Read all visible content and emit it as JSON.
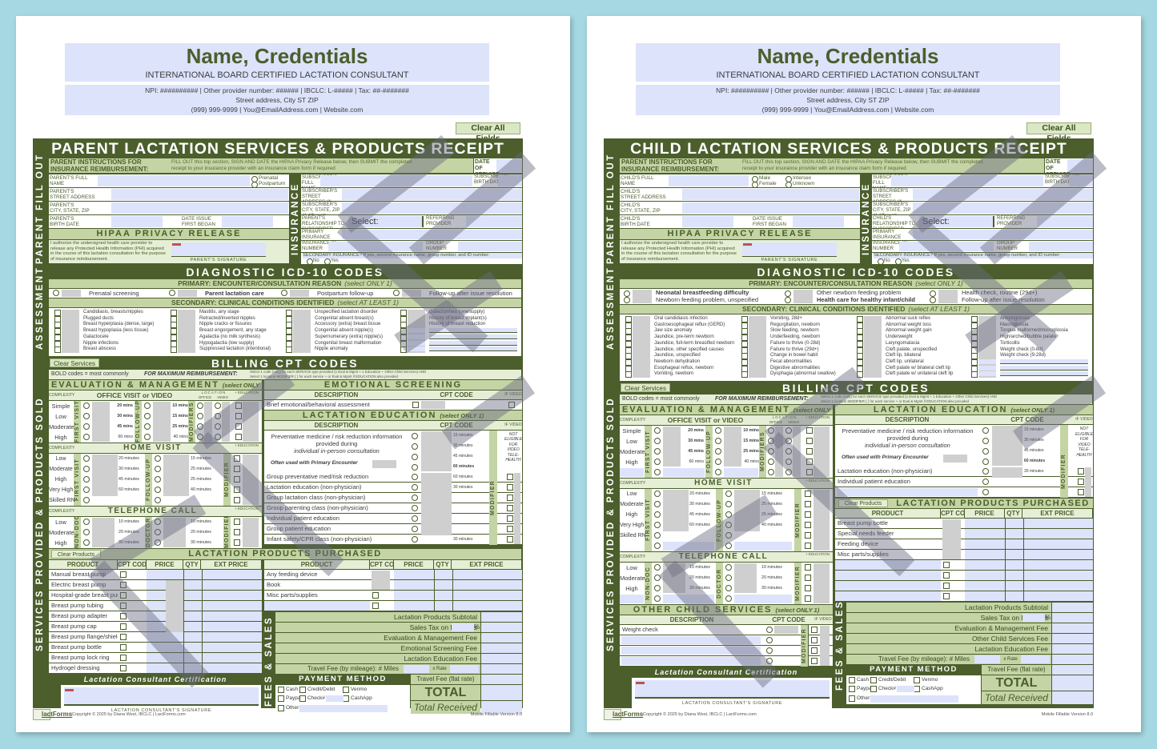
{
  "header": {
    "name": "Name, Credentials",
    "subtitle": "INTERNATIONAL BOARD CERTIFIED LACTATION CONSULTANT",
    "ids_line": "NPI: ########## | Other provider number: ###### | IBCLC: L-##### | Tax: ##-#######",
    "address": "Street address, City ST ZIP",
    "contact": "(999) 999-9999 | You@EmailAddress.com | Website.com"
  },
  "buttons": {
    "clear_all": "Clear All Fields",
    "clear_services": "Clear Services",
    "clear_products": "Clear Products"
  },
  "common": {
    "instructions_title": "PARENT INSTRUCTIONS FOR INSURANCE REIMBURSEMENT:",
    "instructions_text": "FILL OUT this top section, SIGN AND DATE the HIPAA Privacy Release below, then SUBMIT the completed receipt to your insurance provider with an insurance claim form if required",
    "date_of_service": "DATE OF SERVICE",
    "street_address": "STREET ADDRESS",
    "city_state_zip": "CITY, STATE, ZIP",
    "birth_date": "BIRTH DATE",
    "date_issue": "DATE ISSUE FIRST BEGAN",
    "hipaa_title": "HIPAA PRIVACY RELEASE",
    "hipaa_text": "I authorize the undersigned health care provider to release any Protected Health Information (PHI) acquired in the course of this lactation consultation for the purpose of insurance reimbursement.",
    "parent_signature": "PARENT'S SIGNATURE",
    "subscriber_full_name": "SUBSCRIBER'S FULL NAME",
    "subscriber_birth_date": "SUBSCRIBER'S BIRTH DATE",
    "subscriber_street": "SUBSCRIBER'S STREET ADDRESS (if different)",
    "subscriber_city": "SUBSCRIBER'S CITY, STATE, ZIP (if different)",
    "select_placeholder": "Select:",
    "referring_provider": "REFERRING PROVIDER",
    "primary_insurance": "PRIMARY INSURANCE COMPANY NAME",
    "insurance_id": "INSURANCE ID NUMBER",
    "group_number": "GROUP NUMBER",
    "secondary_insurance": "SECONDARY INSURANCE?  If yes, second insurance name, group number, and ID number:",
    "no": "No",
    "yes": "Yes",
    "vlabel_parent": "PARENT FILL OUT",
    "vlabel_insurance": "INSURANCE",
    "vlabel_assessment": "ASSESSMENT",
    "vlabel_services": "SERVICES PROVIDED & PRODUCTS SOLD",
    "vlabel_fees": "FEES & SALES",
    "icd_title": "DIAGNOSTIC ICD-10 CODES",
    "primary_heading": "PRIMARY:  ENCOUNTER/CONSULTATION REASON",
    "primary_note": "(select ONLY 1)",
    "secondary_heading": "SECONDARY:  CLINICAL CONDITIONS IDENTIFIED",
    "secondary_note": "(select AT LEAST 1)",
    "billing_title": "BILLING CPT CODES",
    "bold_codes": "BOLD codes = most commonly reimbursed",
    "max_reimb": "FOR MAXIMUM REIMBURSEMENT:",
    "max_reimb_text1": "Select 1 code (only) for each SERVICE type provided (1 Eval & Mgmt + 1 Education + Other Child Services) AND",
    "max_reimb_text2": "Select 1 location MODIFIER (          ) for each service +      or Eval & Mgmt if EDUCATION also provided",
    "em_title": "EVALUATION & MANAGEMENT",
    "select_only_1": "(select ONLY 1)",
    "complexity": "COMPLEXITY",
    "office_visit": "OFFICE VISIT or VIDEO TELEHEALTH",
    "location": "LOCATION",
    "office": "OFFICE",
    "video": "VIDEO",
    "plus_education": "+ EDUCATION",
    "first_visit": "FIRST VISIT",
    "follow_up": "FOLLOW-UP",
    "modifiers": "MODIFIERS",
    "modifier": "MODIFIER",
    "office_rows": [
      {
        "level": "Simple",
        "first": "20 mins",
        "follow": "10 mins"
      },
      {
        "level": "Low",
        "first": "30 mins",
        "follow": "15 mins"
      },
      {
        "level": "Moderate",
        "first": "45 mins",
        "follow": "25 mins"
      },
      {
        "level": "High",
        "first": "60 mins",
        "follow": "40 mins"
      }
    ],
    "home_visit": "HOME VISIT",
    "home_rows": [
      {
        "level": "Low",
        "first": "20 minutes",
        "follow": "15 minutes"
      },
      {
        "level": "Moderate",
        "first": "30 minutes",
        "follow": "25 minutes"
      },
      {
        "level": "High",
        "first": "45 minutes",
        "follow": "25 minutes"
      },
      {
        "level": "Very High",
        "first": "60 minutes",
        "follow": "40 minutes"
      },
      {
        "level": "Skilled RN",
        "first": "",
        "follow": ""
      }
    ],
    "telephone_call": "TELEPHONE CALL",
    "non_doc": "NON-DOC",
    "doctor": "DOCTOR",
    "phone_rows": [
      {
        "level": "Low",
        "first": "10 minutes",
        "follow": "10 minutes"
      },
      {
        "level": "Moderate",
        "first": "20 minutes",
        "follow": "20 minutes"
      },
      {
        "level": "High",
        "first": "30 minutes",
        "follow": "30 minutes"
      }
    ],
    "lact_ed_title": "LACTATION EDUCATION",
    "description": "DESCRIPTION",
    "cpt_code": "CPT CODE",
    "if_video": "IF VIDEO",
    "preventative": "Preventative medicine / risk reduction information provided during",
    "individual_in_person": "individual in-person consultation",
    "often_used": "Often used with Primary Encounter",
    "ed_times": [
      "15 minutes",
      "30 minutes",
      "45 minutes",
      "60 minutes"
    ],
    "not_eligible": "NOT ELIGIBLE FOR VIDEO TELE-HEALTH",
    "products_title": "LACTATION PRODUCTS PURCHASED",
    "product": "PRODUCT",
    "price": "PRICE",
    "qty": "QTY",
    "ext_price": "EXT PRICE",
    "products_subtotal": "Lactation Products Subtotal",
    "sales_tax": "Sales Tax on Products",
    "percent": "%",
    "em_fee": "Evaluation & Management Fee",
    "lact_ed_fee": "Lactation Education Fee",
    "travel_fee_mileage": "Travel Fee (by mileage): # Miles",
    "x_rate": "x Rate",
    "travel_fee_flat": "Travel Fee (flat rate)",
    "certification": "Lactation Consultant Certification",
    "consultant_signature": "LACTATION CONSULTANT'S SIGNATURE",
    "payment_method": "PAYMENT METHOD",
    "payments": [
      "Cash",
      "Credit/Debit",
      "Venmo",
      "Paypal",
      "Check#",
      "CashApp",
      "Other:"
    ],
    "total_due": "TOTAL DUE",
    "total_received": "Total Received",
    "logo": "lactForms",
    "copyright": "Copyright © 2025 by Diana West, IBCLC  |  LactForms.com",
    "version": "Mobile Fillable Version 8.0"
  },
  "parent": {
    "title": "PARENT LACTATION SERVICES & PRODUCTS RECEIPT",
    "full_name": "PARENT'S FULL NAME",
    "who": "PARENT'S",
    "status_options": [
      "Prenatal",
      "Postpartum"
    ],
    "relationship": "PARENT'S RELATIONSHIP TO SUBSCRIBER",
    "primary_options": [
      "Prenatal screening",
      "Parent lactation care",
      "Postpartum follow-up",
      "Follow-up after issue resolution"
    ],
    "secondary_cols": [
      [
        "Candidiasis, breasts/nipples",
        "Plugged ducts",
        "Breast hyperplasia (dense, large)",
        "Breast hypoplasia (less tissue)",
        "Galactocele",
        "Nipple infections",
        "Breast abscess"
      ],
      [
        "Mastitis, any stage",
        "Retracted/inverted nipples",
        "Nipple cracks or fissures",
        "Breast engorgement, any stage",
        "Agalactia (no milk synthesis)",
        "Hypogalactia (low supply)",
        "Suppressed lactation (intentional)"
      ],
      [
        "Unspecified lactation disorder",
        "Congenital absent breast(s)",
        "Accessory (extra) breast tissue",
        "Congenital absent nipple(s)",
        "Supernumerary (extra) nipple(s)",
        "Congenital breast malformation",
        "Nipple anomaly"
      ],
      [
        "Galactorrhea (oversupply)",
        "History of breast implant(s)",
        "History of breast reduction"
      ]
    ],
    "emotional_title": "EMOTIONAL SCREENING",
    "emotional_row": "Brief emotional/behavioral assessment",
    "education_rows": [
      {
        "label": "Group preventative med/risk reduction",
        "time": "60 minutes"
      },
      {
        "label": "Lactation education (non-physician)",
        "time": "30 minutes"
      },
      {
        "label": "Group lactation class (non-physician)",
        "time": ""
      },
      {
        "label": "Group parenting class (non-physician)",
        "time": ""
      },
      {
        "label": "Individual patient education",
        "time": ""
      },
      {
        "label": "Group patient education",
        "time": ""
      },
      {
        "label": "Infant safety/CPR class (non-physician)",
        "time": "30 minutes"
      }
    ],
    "products_left": [
      "Manual breast pump",
      "Electric breast pump",
      "Hospital-grade breast pump",
      "Breast pump tubing",
      "Breast pump adapter",
      "Breast pump cap",
      "Breast pump flange/shield",
      "Breast pump bottle",
      "Breast pump lock ring",
      "Hydrogel dressing"
    ],
    "products_right": [
      "Any feeding device",
      "Book",
      "Misc parts/supplies",
      ""
    ],
    "screening_fee": "Emotional Screening Fee"
  },
  "child": {
    "title": "CHILD LACTATION SERVICES & PRODUCTS RECEIPT",
    "full_name": "CHILD'S FULL NAME",
    "who": "CHILD'S",
    "status_options": [
      "Male",
      "Intersex",
      "Female",
      "Unknown"
    ],
    "relationship": "CHILD'S RELATIONSHIP TO SUBSCRIBER",
    "primary_options": [
      "Neonatal breastfeeding difficulty",
      "Newborn feeding problem, unspecified",
      "Other newborn feeding problem",
      "Health care for healthy infant/child",
      "Health check, routine (29d+)",
      "Follow-up after issue resolution"
    ],
    "secondary_cols": [
      [
        "Oral candidiasis infection",
        "Gastroesophageal reflux (GERD)",
        "Jaw size anomaly",
        "Jaundice, pre-term newborn",
        "Jaundice, full-term breastfed newborn",
        "Jaundice, other specified causes",
        "Jaundice, unspecified",
        "Newborn dehydration",
        "Esophageal reflux, newborn",
        "Vomiting, newborn"
      ],
      [
        "Vomiting, 28d+",
        "Regurgitation, newborn",
        "Slow feeding, newborn",
        "Underfeeding, newborn",
        "Failure to thrive (0-28d)",
        "Failure to thrive (29d+)",
        "Change in bowel habit",
        "Fecal abnormalities",
        "Digestive abnormalities",
        "Dysphagia (abnormal swallow)"
      ],
      [
        "Abnormal suck reflex",
        "Abnormal weight loss",
        "Abnormal weight gain",
        "Underweight",
        "Laryngomalacia",
        "Cleft palate, unspecified",
        "Cleft lip, bilateral",
        "Cleft lip, unilateral",
        "Cleft palate w/ bilateral cleft lip",
        "Cleft palate w/ unilateral cleft lip"
      ],
      [
        "Ankyloglossia",
        "Macroglossia",
        "Tongue malformed/microglossia",
        "High/arched/bubble palate",
        "Torticollis",
        "Weight check (0-8d)",
        "Weight check (9-28d)"
      ]
    ],
    "education_rows": [
      {
        "label": "Lactation education (non-physician)",
        "time": "30 minutes"
      },
      {
        "label": "Individual patient education",
        "time": ""
      }
    ],
    "other_title": "OTHER CHILD SERVICES",
    "other_rows": [
      "Weight check",
      "",
      "",
      ""
    ],
    "products": [
      "Breast pump bottle",
      "Special needs feeder",
      "Feeding device",
      "Misc parts/supplies"
    ],
    "other_fee": "Other Child Services Fee"
  }
}
